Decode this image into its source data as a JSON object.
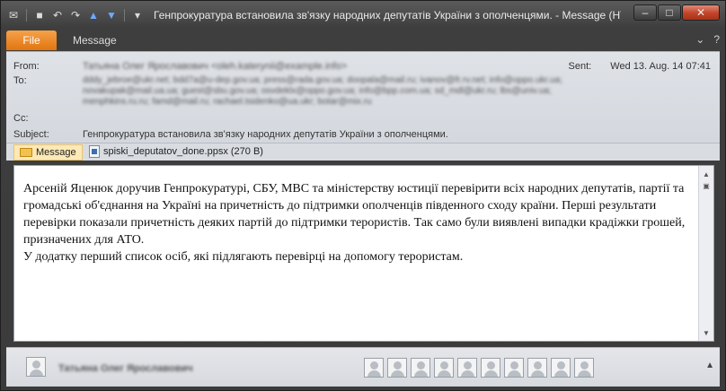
{
  "window": {
    "title": "Генпрокуратура встановила зв'язку народних депутатів України з ополченцями.  -  Message (HTML)"
  },
  "ribbon": {
    "file_tab": "File",
    "message_tab": "Message"
  },
  "header": {
    "from_label": "From:",
    "from_value": "Татьяна Олег Ярославович <oleh.katerynii@example.info>",
    "to_label": "To:",
    "to_lines": [
      "dddy_jebroe@ukr.net; bdd7a@u-dep.gov.ua; press@rada.gov.ua; doopala@mail.ru; ivanov@fr.rv.net; info@oppo.ukr.ua;",
      "novakupak@mail.ua.ua; guest@sbu.gov.ua; osvdeklx@oppo.gov.ua; info@bpp.com.ua; sd_mdl@ukr.ru; lbs@univ.ua;",
      "menphkins.ru.ru; famd@mail.ru; rachael.tsidenko@ua.ukr; botar@mix.ru"
    ],
    "cc_label": "Cc:",
    "subject_label": "Subject:",
    "subject_value": "Генпрокуратура встановила зв'язку народних депутатів України з ополченцями.",
    "sent_label": "Sent:",
    "sent_value": "Wed 13. Aug. 14 07:41"
  },
  "attachments": {
    "message_tab": "Message",
    "file_name": "spiski_deputatov_done.ppsx (270 B)"
  },
  "body": {
    "paragraph1": "Арсеній Яценюк доручив Генпрокуратурі, СБУ, МВС та міністерству юстиції перевірити всіх народних депутатів, партії та громадські об'єднання на Україні на причетність до підтримки ополченців південного сходу країни. Перші результати перевірки показали причетність деяких партій до підтримки терористів. Так само були виявлені випадки крадіжки грошей, призначених для АТО.",
    "paragraph2": "У додатку перший список осіб, які підлягають перевірці на допомогу терористам."
  },
  "people_pane": {
    "name": "Татьяна Олег Ярославович",
    "contact_count": 10
  }
}
